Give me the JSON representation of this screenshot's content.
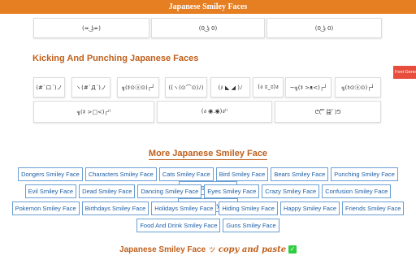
{
  "header": {
    "title": "Japanese Smiley Faces"
  },
  "top_row": [
    "(≖ ͜ʖ≖)",
    "(0 ͜ʖ 0)",
    "(0 ͜ʖ 0)"
  ],
  "kicking": {
    "title": "Kicking And Punching Japanese Faces",
    "row1": [
      "(#`ロ´)ノ",
      "ヽ(#`Д´)ノ",
      "╗(ｷ⊙ⓐ⊙)┌┘",
      "((ヽ(⊙⌒⊙)ﾉ)",
      "(ﾒ ◣ ◢ )ﾉ",
      "(ง ಠ_ಠ)ง",
      "~╗(ｷ >ᴥ<)┌┘",
      "╗(ｷ⊙ⓐ⊙)┌┘"
    ],
    "row2": [
      "╗(ｷ >□<)┌⁾⁾",
      "(ง ◉.◉)ง⁾⁾",
      "ᕦ( ̿ﾟ益ﾟ)ᕤ"
    ]
  },
  "more": {
    "title": "More Japanese Smiley Face",
    "rows": [
      [
        "Dongers Smiley Face",
        "Characters Smiley Face",
        "Cats Smiley Face",
        "Bird Smiley Face",
        "Bears Smiley Face",
        "Punching Smiley Face",
        "Exited Smiley Face"
      ],
      [
        "Evil Smiley Face",
        "Dead Smiley Face",
        "Dancing Smiley Face",
        "Eyes Smiley Face",
        "Crazy Smiley Face",
        "Confusion Smiley Face",
        "Clouds Smiley Face"
      ],
      [
        "Pokemon Smiley Face",
        "Birthdays Smiley Face",
        "Holidays Smiley Face",
        "Hiding Smiley Face",
        "Happy Smiley Face",
        "Friends Smiley Face"
      ],
      [
        "Food And Drink Smiley Face",
        "Guns Smiley Face"
      ]
    ]
  },
  "side_button": {
    "label": "Font Gene"
  },
  "footer": {
    "text1": "Japanese Smiley Face",
    "emoji": "ッ",
    "text2": "copy and paste",
    "check": "✓"
  },
  "icons": {
    "check": "check-icon"
  },
  "colors": {
    "accent": "#e67e22",
    "title": "#c0601c",
    "tag_border": "#6a9fd4",
    "tag_text": "#1e5fa8",
    "side_button": "#e74c3c"
  }
}
